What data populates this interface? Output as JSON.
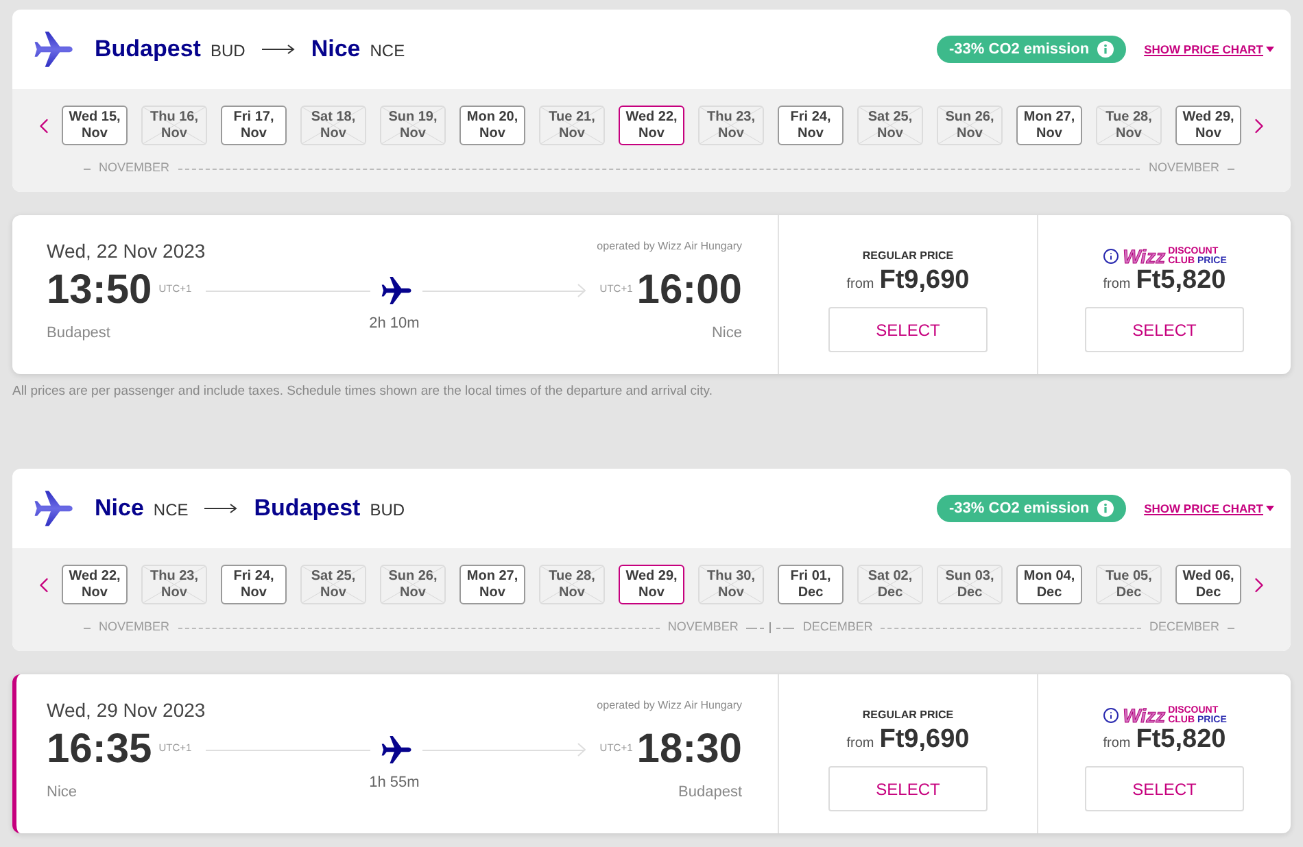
{
  "trips": [
    {
      "header": {
        "from_city": "Budapest",
        "from_code": "BUD",
        "to_city": "Nice",
        "to_code": "NCE",
        "co2_badge": "-33% CO2 emission",
        "price_chart_link": "SHOW PRICE CHART"
      },
      "date_strip": {
        "months": [
          {
            "start_label": "NOVEMBER",
            "end_label": "NOVEMBER",
            "dates": [
              {
                "day": "Wed 15,",
                "month": "Nov",
                "available": true,
                "selected": false
              },
              {
                "day": "Thu 16,",
                "month": "Nov",
                "available": false,
                "selected": false
              },
              {
                "day": "Fri 17,",
                "month": "Nov",
                "available": true,
                "selected": false
              },
              {
                "day": "Sat 18,",
                "month": "Nov",
                "available": false,
                "selected": false
              },
              {
                "day": "Sun 19,",
                "month": "Nov",
                "available": false,
                "selected": false
              },
              {
                "day": "Mon 20,",
                "month": "Nov",
                "available": true,
                "selected": false
              },
              {
                "day": "Tue 21,",
                "month": "Nov",
                "available": false,
                "selected": false
              },
              {
                "day": "Wed 22,",
                "month": "Nov",
                "available": true,
                "selected": true
              },
              {
                "day": "Thu 23,",
                "month": "Nov",
                "available": false,
                "selected": false
              },
              {
                "day": "Fri 24,",
                "month": "Nov",
                "available": true,
                "selected": false
              },
              {
                "day": "Sat 25,",
                "month": "Nov",
                "available": false,
                "selected": false
              },
              {
                "day": "Sun 26,",
                "month": "Nov",
                "available": false,
                "selected": false
              },
              {
                "day": "Mon 27,",
                "month": "Nov",
                "available": true,
                "selected": false
              },
              {
                "day": "Tue 28,",
                "month": "Nov",
                "available": false,
                "selected": false
              },
              {
                "day": "Wed 29,",
                "month": "Nov",
                "available": true,
                "selected": false
              }
            ]
          }
        ]
      },
      "flight": {
        "highlighted": false,
        "date": "Wed, 22 Nov 2023",
        "operator": "operated by Wizz Air Hungary",
        "departure_time": "13:50",
        "departure_tz": "UTC+1",
        "departure_city": "Budapest",
        "duration": "2h 10m",
        "arrival_tz": "UTC+1",
        "arrival_time": "16:00",
        "arrival_city": "Nice",
        "fares": [
          {
            "kind": "regular",
            "title": "REGULAR PRICE",
            "from": "from",
            "price": "Ft9,690",
            "button": "SELECT"
          },
          {
            "kind": "club",
            "logo": "Wizz",
            "title_line_1": "DISCOUNT",
            "title_line_2a": "CLUB",
            "title_line_2b": "PRICE",
            "from": "from",
            "price": "Ft5,820",
            "button": "SELECT"
          }
        ]
      },
      "footnote": "All prices are per passenger and include taxes. Schedule times shown are the local times of the departure and arrival city."
    },
    {
      "header": {
        "from_city": "Nice",
        "from_code": "NCE",
        "to_city": "Budapest",
        "to_code": "BUD",
        "co2_badge": "-33% CO2 emission",
        "price_chart_link": "SHOW PRICE CHART"
      },
      "date_strip": {
        "months": [
          {
            "start_label": "NOVEMBER",
            "end_label": "NOVEMBER",
            "dates": [
              {
                "day": "Wed 22,",
                "month": "Nov",
                "available": true,
                "selected": false
              },
              {
                "day": "Thu 23,",
                "month": "Nov",
                "available": false,
                "selected": false
              },
              {
                "day": "Fri 24,",
                "month": "Nov",
                "available": true,
                "selected": false
              },
              {
                "day": "Sat 25,",
                "month": "Nov",
                "available": false,
                "selected": false
              },
              {
                "day": "Sun 26,",
                "month": "Nov",
                "available": false,
                "selected": false
              },
              {
                "day": "Mon 27,",
                "month": "Nov",
                "available": true,
                "selected": false
              },
              {
                "day": "Tue 28,",
                "month": "Nov",
                "available": false,
                "selected": false
              },
              {
                "day": "Wed 29,",
                "month": "Nov",
                "available": true,
                "selected": true
              },
              {
                "day": "Thu 30,",
                "month": "Nov",
                "available": false,
                "selected": false
              }
            ]
          },
          {
            "start_label": "DECEMBER",
            "end_label": "DECEMBER",
            "dates": [
              {
                "day": "Fri 01,",
                "month": "Dec",
                "available": true,
                "selected": false
              },
              {
                "day": "Sat 02,",
                "month": "Dec",
                "available": false,
                "selected": false
              },
              {
                "day": "Sun 03,",
                "month": "Dec",
                "available": false,
                "selected": false
              },
              {
                "day": "Mon 04,",
                "month": "Dec",
                "available": true,
                "selected": false
              },
              {
                "day": "Tue 05,",
                "month": "Dec",
                "available": false,
                "selected": false
              },
              {
                "day": "Wed 06,",
                "month": "Dec",
                "available": true,
                "selected": false
              }
            ]
          }
        ]
      },
      "flight": {
        "highlighted": true,
        "date": "Wed, 29 Nov 2023",
        "operator": "operated by Wizz Air Hungary",
        "departure_time": "16:35",
        "departure_tz": "UTC+1",
        "departure_city": "Nice",
        "duration": "1h 55m",
        "arrival_tz": "UTC+1",
        "arrival_time": "18:30",
        "arrival_city": "Budapest",
        "fares": [
          {
            "kind": "regular",
            "title": "REGULAR PRICE",
            "from": "from",
            "price": "Ft9,690",
            "button": "SELECT"
          },
          {
            "kind": "club",
            "logo": "Wizz",
            "title_line_1": "DISCOUNT",
            "title_line_2a": "CLUB",
            "title_line_2b": "PRICE",
            "from": "from",
            "price": "Ft5,820",
            "button": "SELECT"
          }
        ]
      }
    }
  ]
}
